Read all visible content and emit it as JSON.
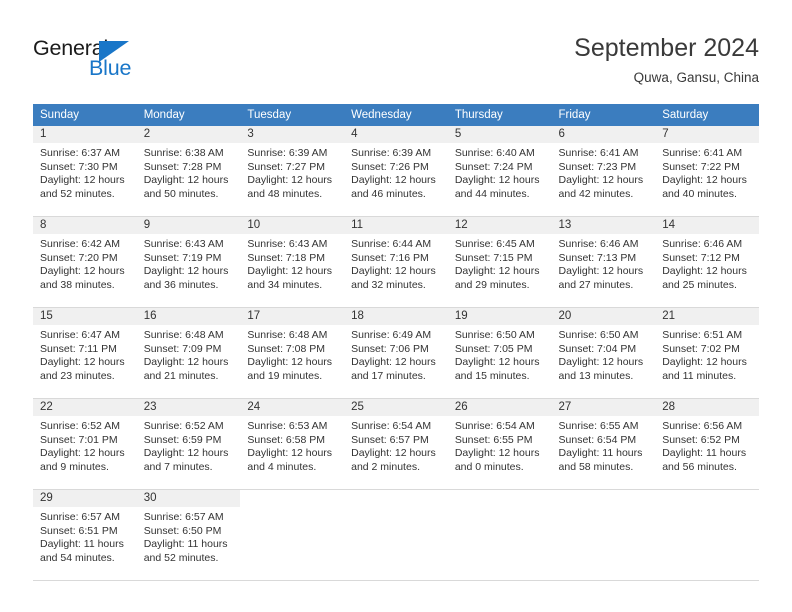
{
  "logo": {
    "word_top": "General",
    "word_bottom": "Blue",
    "triangle_color": "#1976c8"
  },
  "header": {
    "title": "September 2024",
    "location": "Quwa, Gansu, China"
  },
  "theme": {
    "header_bg": "#3b7dbf",
    "daynum_bg": "#f0f0f0",
    "text": "#333333",
    "border": "#d9d9d9"
  },
  "weekday_headers": [
    "Sunday",
    "Monday",
    "Tuesday",
    "Wednesday",
    "Thursday",
    "Friday",
    "Saturday"
  ],
  "labels": {
    "sunrise_prefix": "Sunrise:",
    "sunset_prefix": "Sunset:",
    "daylight_prefix": "Daylight:"
  },
  "weeks": [
    [
      {
        "day": "1",
        "sunrise": "Sunrise: 6:37 AM",
        "sunset": "Sunset: 7:30 PM",
        "daylight_line1": "Daylight: 12 hours",
        "daylight_line2": "and 52 minutes."
      },
      {
        "day": "2",
        "sunrise": "Sunrise: 6:38 AM",
        "sunset": "Sunset: 7:28 PM",
        "daylight_line1": "Daylight: 12 hours",
        "daylight_line2": "and 50 minutes."
      },
      {
        "day": "3",
        "sunrise": "Sunrise: 6:39 AM",
        "sunset": "Sunset: 7:27 PM",
        "daylight_line1": "Daylight: 12 hours",
        "daylight_line2": "and 48 minutes."
      },
      {
        "day": "4",
        "sunrise": "Sunrise: 6:39 AM",
        "sunset": "Sunset: 7:26 PM",
        "daylight_line1": "Daylight: 12 hours",
        "daylight_line2": "and 46 minutes."
      },
      {
        "day": "5",
        "sunrise": "Sunrise: 6:40 AM",
        "sunset": "Sunset: 7:24 PM",
        "daylight_line1": "Daylight: 12 hours",
        "daylight_line2": "and 44 minutes."
      },
      {
        "day": "6",
        "sunrise": "Sunrise: 6:41 AM",
        "sunset": "Sunset: 7:23 PM",
        "daylight_line1": "Daylight: 12 hours",
        "daylight_line2": "and 42 minutes."
      },
      {
        "day": "7",
        "sunrise": "Sunrise: 6:41 AM",
        "sunset": "Sunset: 7:22 PM",
        "daylight_line1": "Daylight: 12 hours",
        "daylight_line2": "and 40 minutes."
      }
    ],
    [
      {
        "day": "8",
        "sunrise": "Sunrise: 6:42 AM",
        "sunset": "Sunset: 7:20 PM",
        "daylight_line1": "Daylight: 12 hours",
        "daylight_line2": "and 38 minutes."
      },
      {
        "day": "9",
        "sunrise": "Sunrise: 6:43 AM",
        "sunset": "Sunset: 7:19 PM",
        "daylight_line1": "Daylight: 12 hours",
        "daylight_line2": "and 36 minutes."
      },
      {
        "day": "10",
        "sunrise": "Sunrise: 6:43 AM",
        "sunset": "Sunset: 7:18 PM",
        "daylight_line1": "Daylight: 12 hours",
        "daylight_line2": "and 34 minutes."
      },
      {
        "day": "11",
        "sunrise": "Sunrise: 6:44 AM",
        "sunset": "Sunset: 7:16 PM",
        "daylight_line1": "Daylight: 12 hours",
        "daylight_line2": "and 32 minutes."
      },
      {
        "day": "12",
        "sunrise": "Sunrise: 6:45 AM",
        "sunset": "Sunset: 7:15 PM",
        "daylight_line1": "Daylight: 12 hours",
        "daylight_line2": "and 29 minutes."
      },
      {
        "day": "13",
        "sunrise": "Sunrise: 6:46 AM",
        "sunset": "Sunset: 7:13 PM",
        "daylight_line1": "Daylight: 12 hours",
        "daylight_line2": "and 27 minutes."
      },
      {
        "day": "14",
        "sunrise": "Sunrise: 6:46 AM",
        "sunset": "Sunset: 7:12 PM",
        "daylight_line1": "Daylight: 12 hours",
        "daylight_line2": "and 25 minutes."
      }
    ],
    [
      {
        "day": "15",
        "sunrise": "Sunrise: 6:47 AM",
        "sunset": "Sunset: 7:11 PM",
        "daylight_line1": "Daylight: 12 hours",
        "daylight_line2": "and 23 minutes."
      },
      {
        "day": "16",
        "sunrise": "Sunrise: 6:48 AM",
        "sunset": "Sunset: 7:09 PM",
        "daylight_line1": "Daylight: 12 hours",
        "daylight_line2": "and 21 minutes."
      },
      {
        "day": "17",
        "sunrise": "Sunrise: 6:48 AM",
        "sunset": "Sunset: 7:08 PM",
        "daylight_line1": "Daylight: 12 hours",
        "daylight_line2": "and 19 minutes."
      },
      {
        "day": "18",
        "sunrise": "Sunrise: 6:49 AM",
        "sunset": "Sunset: 7:06 PM",
        "daylight_line1": "Daylight: 12 hours",
        "daylight_line2": "and 17 minutes."
      },
      {
        "day": "19",
        "sunrise": "Sunrise: 6:50 AM",
        "sunset": "Sunset: 7:05 PM",
        "daylight_line1": "Daylight: 12 hours",
        "daylight_line2": "and 15 minutes."
      },
      {
        "day": "20",
        "sunrise": "Sunrise: 6:50 AM",
        "sunset": "Sunset: 7:04 PM",
        "daylight_line1": "Daylight: 12 hours",
        "daylight_line2": "and 13 minutes."
      },
      {
        "day": "21",
        "sunrise": "Sunrise: 6:51 AM",
        "sunset": "Sunset: 7:02 PM",
        "daylight_line1": "Daylight: 12 hours",
        "daylight_line2": "and 11 minutes."
      }
    ],
    [
      {
        "day": "22",
        "sunrise": "Sunrise: 6:52 AM",
        "sunset": "Sunset: 7:01 PM",
        "daylight_line1": "Daylight: 12 hours",
        "daylight_line2": "and 9 minutes."
      },
      {
        "day": "23",
        "sunrise": "Sunrise: 6:52 AM",
        "sunset": "Sunset: 6:59 PM",
        "daylight_line1": "Daylight: 12 hours",
        "daylight_line2": "and 7 minutes."
      },
      {
        "day": "24",
        "sunrise": "Sunrise: 6:53 AM",
        "sunset": "Sunset: 6:58 PM",
        "daylight_line1": "Daylight: 12 hours",
        "daylight_line2": "and 4 minutes."
      },
      {
        "day": "25",
        "sunrise": "Sunrise: 6:54 AM",
        "sunset": "Sunset: 6:57 PM",
        "daylight_line1": "Daylight: 12 hours",
        "daylight_line2": "and 2 minutes."
      },
      {
        "day": "26",
        "sunrise": "Sunrise: 6:54 AM",
        "sunset": "Sunset: 6:55 PM",
        "daylight_line1": "Daylight: 12 hours",
        "daylight_line2": "and 0 minutes."
      },
      {
        "day": "27",
        "sunrise": "Sunrise: 6:55 AM",
        "sunset": "Sunset: 6:54 PM",
        "daylight_line1": "Daylight: 11 hours",
        "daylight_line2": "and 58 minutes."
      },
      {
        "day": "28",
        "sunrise": "Sunrise: 6:56 AM",
        "sunset": "Sunset: 6:52 PM",
        "daylight_line1": "Daylight: 11 hours",
        "daylight_line2": "and 56 minutes."
      }
    ],
    [
      {
        "day": "29",
        "sunrise": "Sunrise: 6:57 AM",
        "sunset": "Sunset: 6:51 PM",
        "daylight_line1": "Daylight: 11 hours",
        "daylight_line2": "and 54 minutes."
      },
      {
        "day": "30",
        "sunrise": "Sunrise: 6:57 AM",
        "sunset": "Sunset: 6:50 PM",
        "daylight_line1": "Daylight: 11 hours",
        "daylight_line2": "and 52 minutes."
      },
      {
        "day": "",
        "sunrise": "",
        "sunset": "",
        "daylight_line1": "",
        "daylight_line2": ""
      },
      {
        "day": "",
        "sunrise": "",
        "sunset": "",
        "daylight_line1": "",
        "daylight_line2": ""
      },
      {
        "day": "",
        "sunrise": "",
        "sunset": "",
        "daylight_line1": "",
        "daylight_line2": ""
      },
      {
        "day": "",
        "sunrise": "",
        "sunset": "",
        "daylight_line1": "",
        "daylight_line2": ""
      },
      {
        "day": "",
        "sunrise": "",
        "sunset": "",
        "daylight_line1": "",
        "daylight_line2": ""
      }
    ]
  ]
}
